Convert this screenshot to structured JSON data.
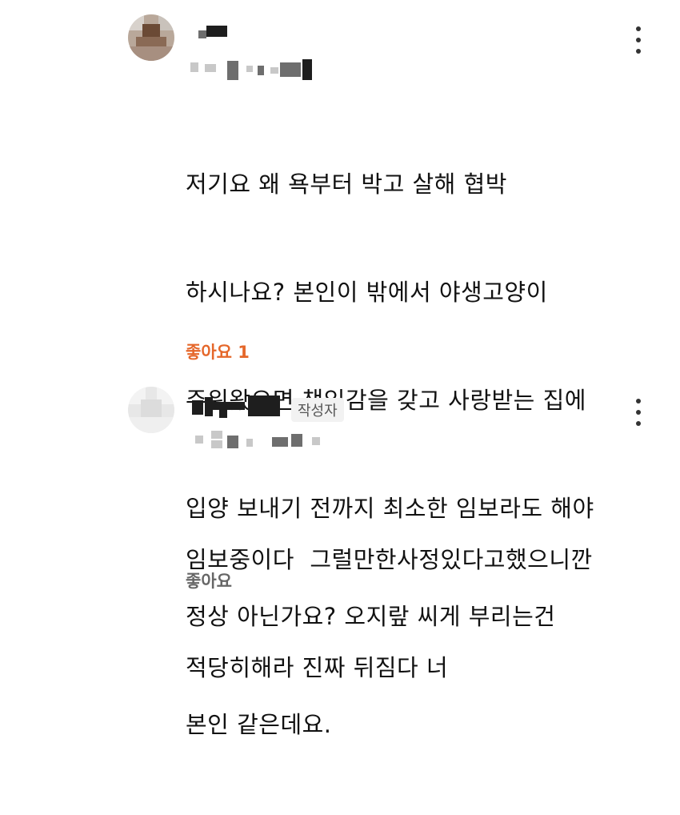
{
  "colors": {
    "like_active": "#e5672a",
    "like_inactive": "#666666"
  },
  "comments": [
    {
      "author_name": "",
      "body_lines": [
        "저기요 왜 욕부터 박고 살해 협박",
        "하시나요? 본인이 밖에서 야생고양이",
        "주워왔으면 책임감을 갖고 사랑받는 집에",
        "입양 보내기 전까지 최소한 임보라도 해야",
        "정상 아닌가요? 오지랖 씨게 부리는건",
        "본인 같은데요."
      ],
      "like_label": "좋아요 1",
      "more_icon": "more-vertical-icon"
    },
    {
      "author_name": "",
      "author_badge": "작성자",
      "body_lines": [
        "임보중이다  그럴만한사정있다고했으니깐",
        "적당히해라 진짜 뒤짐다 너"
      ],
      "like_label": "좋아요",
      "more_icon": "more-vertical-icon"
    }
  ]
}
